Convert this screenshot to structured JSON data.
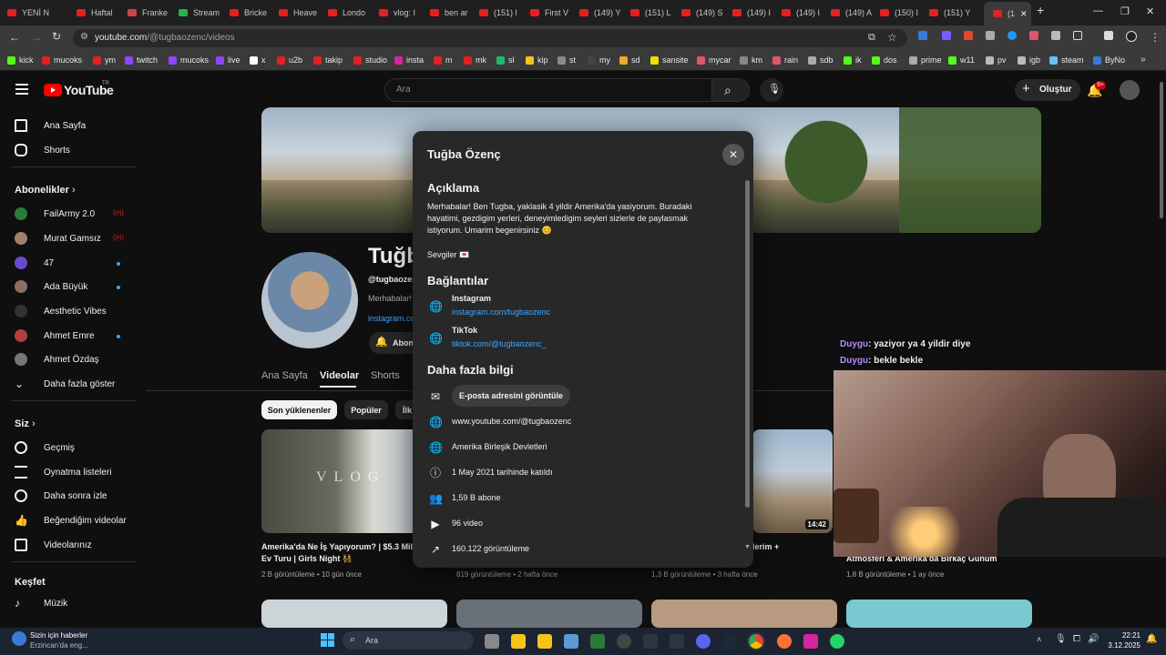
{
  "browser": {
    "tabs": [
      "YENİ N",
      "Haftal",
      "Franke",
      "Stream",
      "Bricke",
      "Heave",
      "Londo",
      "vlog: I",
      "ben ar",
      "(151) l",
      "First V",
      "(149) Y",
      "(151) L",
      "(149) S",
      "(149) I",
      "(149) I",
      "(149) A",
      "(150) I",
      "(151) Y",
      "(1"
    ],
    "url_host": "youtube.com",
    "url_path": "/@tugbaozenc/videos",
    "bookmarks": [
      "kick",
      "mucoks",
      "ym",
      "twitch",
      "mucoks",
      "live",
      "x",
      "u2b",
      "takip",
      "studio",
      "insta",
      "m",
      "mk",
      "sl",
      "kip",
      "st",
      "my",
      "sd",
      "sansite",
      "mycar",
      "km",
      "rain",
      "sdb",
      "ik",
      "dos",
      "prime",
      "w11",
      "pv",
      "igb",
      "steam",
      "ByNo"
    ]
  },
  "header": {
    "logo": "YouTube",
    "logo_suffix": "TR",
    "search_placeholder": "Ara",
    "create_label": "Oluştur",
    "notif_badge": "9+"
  },
  "sidebar": {
    "home": "Ana Sayfa",
    "shorts": "Shorts",
    "subs_heading": "Abonelikler",
    "subs": [
      {
        "name": "FailArmy 2.0",
        "status": "live"
      },
      {
        "name": "Murat Gamsız",
        "status": "live"
      },
      {
        "name": "47",
        "status": "new"
      },
      {
        "name": "Ada Büyük",
        "status": "new"
      },
      {
        "name": "Aesthetic Vibes",
        "status": ""
      },
      {
        "name": "Ahmet Emre",
        "status": "new"
      },
      {
        "name": "Ahmet Özdaş",
        "status": ""
      }
    ],
    "more": "Daha fazla göster",
    "you_heading": "Siz",
    "you_items": [
      "Geçmiş",
      "Oynatma listeleri",
      "Daha sonra izle",
      "Beğendiğim videolar",
      "Videolarınız"
    ],
    "explore_heading": "Keşfet",
    "explore_items": [
      "Müzik"
    ]
  },
  "channel": {
    "name_partial": "Tuğb",
    "handle_partial": "@tugbaozen",
    "desc_partial": "Merhabalar!",
    "link_partial": "instagram.co",
    "subscribe_partial": "Abon",
    "tabs": [
      "Ana Sayfa",
      "Videolar",
      "Shorts"
    ],
    "chips": [
      "Son yüklenenler",
      "Popüler",
      "İlk"
    ]
  },
  "videos": [
    {
      "title": "Amerika'da Ne İş Yapıyorum? | $5.3 Milyonluk Ev Turu | Girls Night 👯",
      "views": "2 B görüntüleme",
      "age": "10 gün önce"
    },
    {
      "title": "",
      "views": "819 görüntüleme",
      "age": "2 hafta önce"
    },
    {
      "title": "lerim +",
      "views": "1,3 B görüntüleme",
      "age": "3 hafta önce",
      "duration": "14:42"
    },
    {
      "title": "Atmosferi & Amerika'da Birkaç Günüm",
      "views": "1,8 B görüntüleme",
      "age": "1 ay önce"
    }
  ],
  "modal": {
    "title": "Tuğba Özenç",
    "about_heading": "Açıklama",
    "description": [
      "Merhabalar! Ben Tugba, yaklasik 4 yildir Amerika'da yasiyorum. Buradaki",
      "hayatimi, gezdigim yerleri, deneyimledigim seyleri sizlerle de paylasmak",
      "istiyorum. Umarim begenirsiniz 😊"
    ],
    "signoff": "Sevgiler 💌",
    "links_heading": "Bağlantılar",
    "links": [
      {
        "name": "Instagram",
        "url": "instagram.com/tugbaozenc"
      },
      {
        "name": "TikTok",
        "url": "tiktok.com/@tugbaozenc_"
      }
    ],
    "more_heading": "Daha fazla bilgi",
    "email_button": "E-posta adresini görüntüle",
    "channel_url": "www.youtube.com/@tugbaozenc",
    "country": "Amerika Birleşik Devletleri",
    "joined": "1 May 2021 tarihinde katıldı",
    "subscribers": "1,59 B abone",
    "videos": "96 video",
    "views": "160.122 görüntüleme"
  },
  "chat": [
    {
      "user": "Duygu",
      "text": ": yaziyor ya 4 yildir diye"
    },
    {
      "user": "Duygu",
      "text": ": bekle bekle"
    }
  ],
  "taskbar": {
    "news_title": "Sizin için haberler",
    "news_sub": "Erzincan'da eng...",
    "search": "Ara",
    "time": "22:21",
    "date": "3.12.2025"
  }
}
